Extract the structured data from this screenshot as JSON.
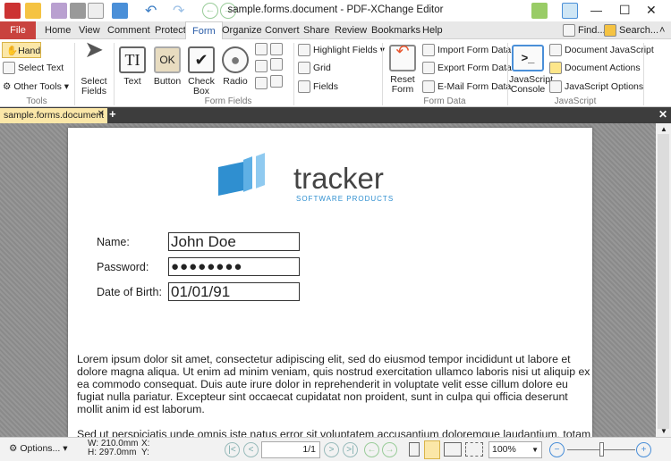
{
  "window": {
    "title": "sample.forms.document - PDF-XChange Editor",
    "minimize": "—",
    "maximize": "☐",
    "close": "✕"
  },
  "menu": {
    "tabs": [
      "File",
      "Home",
      "View",
      "Comment",
      "Protect",
      "Form",
      "Organize",
      "Convert",
      "Share",
      "Review",
      "Bookmarks",
      "Help"
    ],
    "active": "Form",
    "find": "Find...",
    "search": "Search..."
  },
  "ribbon": {
    "tools": {
      "label": "Tools",
      "hand": "Hand",
      "select_text": "Select Text",
      "other_tools": "Other Tools"
    },
    "form_fields": {
      "label": "Form Fields",
      "select_fields": "Select Fields",
      "text": "Text",
      "button": "Button",
      "button_glyph": "OK",
      "check_box": "Check Box",
      "radio": "Radio",
      "highlight_fields": "Highlight Fields",
      "grid": "Grid",
      "fields": "Fields"
    },
    "form_data": {
      "label": "Form Data",
      "reset_form": "Reset Form",
      "import": "Import Form Data",
      "export": "Export Form Data",
      "email": "E-Mail Form Data"
    },
    "javascript": {
      "label": "JavaScript",
      "console": "JavaScript Console",
      "document_js": "Document JavaScript",
      "document_actions": "Document Actions",
      "js_options": "JavaScript Options"
    }
  },
  "document_tab": {
    "name": "sample.forms.document"
  },
  "page": {
    "logo_text": "tracker",
    "logo_sub": "SOFTWARE PRODUCTS",
    "fields": [
      {
        "label": "Name:",
        "value": "John Doe"
      },
      {
        "label": "Password:",
        "value": "●●●●●●●●"
      },
      {
        "label": "Date of Birth:",
        "value": "01/01/91"
      }
    ],
    "para1": "Lorem ipsum dolor sit amet, consectetur adipiscing elit, sed do eiusmod tempor incididunt ut labore et dolore magna aliqua. Ut enim ad minim veniam, quis nostrud exercitation ullamco laboris nisi ut aliquip ex ea commodo consequat. Duis aute irure dolor in reprehenderit in voluptate velit esse cillum dolore eu fugiat nulla pariatur. Excepteur sint occaecat cupidatat non proident, sunt in culpa qui officia deserunt mollit anim id est laborum.",
    "para2": "Sed ut perspiciatis unde omnis iste natus error sit voluptatem accusantium doloremque laudantium, totam"
  },
  "status": {
    "options": "Options...",
    "width": "W: 210.0mm",
    "height": "H: 297.0mm",
    "x": "X:",
    "y": "Y:",
    "page": "1/1",
    "zoom": "100%"
  },
  "colors": {
    "file_tab": "#c9423e",
    "accent": "#2a5ca8",
    "tab_active": "#fbe7a8"
  }
}
